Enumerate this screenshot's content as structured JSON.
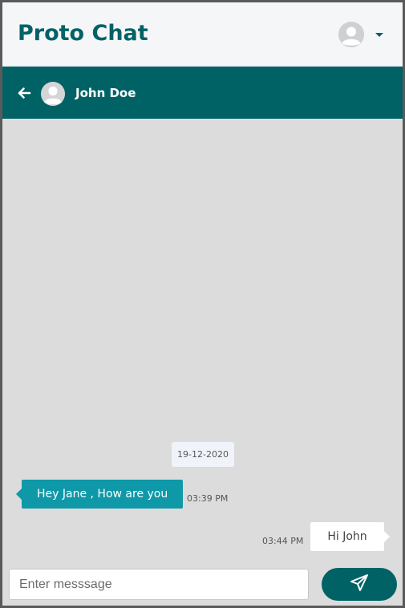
{
  "app": {
    "brand": "Proto Chat"
  },
  "header": {
    "profile_icon": "user-avatar-icon",
    "menu_icon": "caret-down-icon"
  },
  "chat": {
    "back_icon": "arrow-left-icon",
    "contact_avatar_icon": "user-avatar-icon",
    "contact_name": "John Doe"
  },
  "messages": {
    "date": "19-12-2020",
    "items": [
      {
        "direction": "incoming",
        "text": "Hey Jane , How are you",
        "time": "03:39 PM"
      },
      {
        "direction": "outgoing",
        "text": "Hi John",
        "time": "03:44 PM"
      }
    ]
  },
  "composer": {
    "placeholder": "Enter messsage",
    "value": "",
    "send_icon": "paper-plane-icon"
  },
  "colors": {
    "primary": "#016265",
    "incoming_bubble": "#0e98a8",
    "chat_background": "#dcdcdc",
    "header_background": "#f5f6f8"
  }
}
